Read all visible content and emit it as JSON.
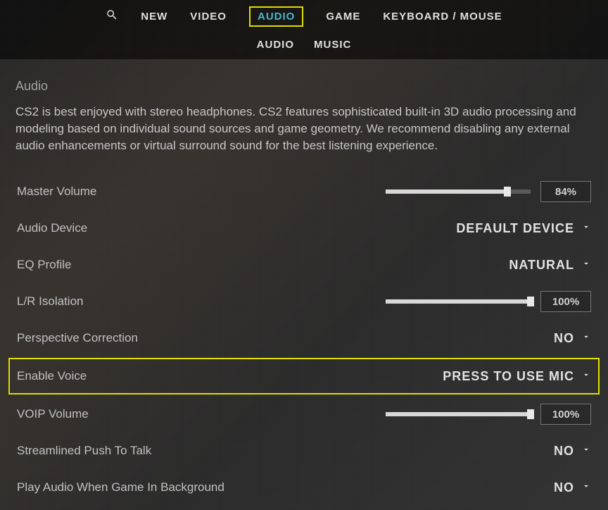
{
  "nav": {
    "primary": [
      "NEW",
      "VIDEO",
      "AUDIO",
      "GAME",
      "KEYBOARD / MOUSE"
    ],
    "primary_active_index": 2,
    "secondary": [
      "AUDIO",
      "MUSIC"
    ]
  },
  "section": {
    "title": "Audio",
    "description": "CS2 is best enjoyed with stereo headphones. CS2 features sophisticated built-in 3D audio processing and modeling based on individual sound sources and game geometry. We recommend disabling any external audio enhancements or virtual surround sound for the best listening experience."
  },
  "settings": {
    "master_volume": {
      "label": "Master Volume",
      "percent": 84,
      "display": "84%"
    },
    "audio_device": {
      "label": "Audio Device",
      "value": "DEFAULT DEVICE"
    },
    "eq_profile": {
      "label": "EQ Profile",
      "value": "NATURAL"
    },
    "lr_isolation": {
      "label": "L/R Isolation",
      "percent": 100,
      "display": "100%"
    },
    "perspective_correction": {
      "label": "Perspective Correction",
      "value": "NO"
    },
    "enable_voice": {
      "label": "Enable Voice",
      "value": "PRESS TO USE MIC"
    },
    "voip_volume": {
      "label": "VOIP Volume",
      "percent": 100,
      "display": "100%"
    },
    "streamlined_ptt": {
      "label": "Streamlined Push To Talk",
      "value": "NO"
    },
    "play_bg_audio": {
      "label": "Play Audio When Game In Background",
      "value": "NO"
    }
  }
}
